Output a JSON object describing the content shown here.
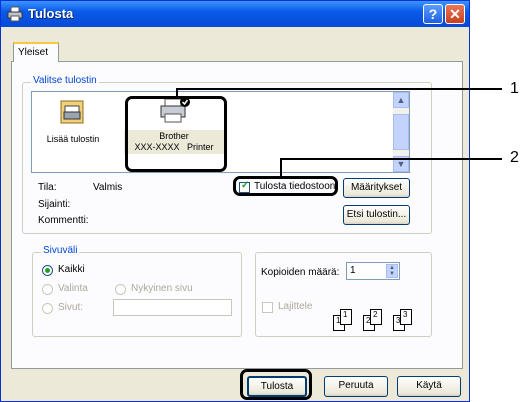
{
  "window": {
    "title": "Tulosta"
  },
  "tabs": [
    {
      "label": "Yleiset"
    }
  ],
  "printer_group": {
    "legend": "Valitse tulostin",
    "items": [
      {
        "label": "Lisää tulostin",
        "icon": "add-printer-icon"
      },
      {
        "label_line1": "Brother",
        "label_line2": "XXX-XXXX   Printer",
        "icon": "printer-icon",
        "selected": true
      }
    ],
    "status_label": "Tila:",
    "status_value": "Valmis",
    "location_label": "Sijainti:",
    "comment_label": "Kommentti:",
    "print_to_file_label": "Tulosta tiedostoon",
    "print_to_file_checked": true,
    "preferences_button": "Määritykset",
    "find_printer_button": "Etsi tulostin..."
  },
  "page_range": {
    "legend": "Sivuväli",
    "options": [
      {
        "label": "Kaikki",
        "selected": true
      },
      {
        "label": "Valinta",
        "enabled": false
      },
      {
        "label": "Nykyinen sivu",
        "enabled": false
      },
      {
        "label": "Sivut:",
        "enabled": false
      }
    ]
  },
  "copies": {
    "label": "Kopioiden määrä:",
    "value": "1",
    "collate_label": "Lajittele",
    "collate_checked": false,
    "page_numbers": [
      "1",
      "1",
      "2",
      "2",
      "3",
      "3"
    ]
  },
  "buttons": {
    "print": "Tulosta",
    "cancel": "Peruuta",
    "apply": "Käytä"
  },
  "callouts": [
    "1",
    "2"
  ]
}
